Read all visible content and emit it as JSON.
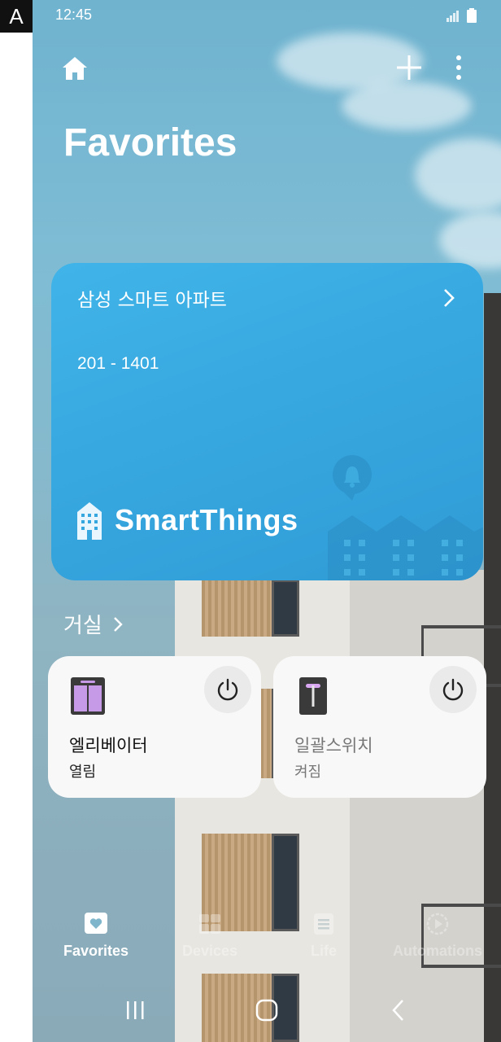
{
  "overlay": {
    "badge": "A"
  },
  "status_bar": {
    "time": "12:45"
  },
  "header": {
    "title": "Favorites"
  },
  "home_card": {
    "name": "삼성 스마트 아파트",
    "unit": "201 - 1401",
    "brand": "SmartThings"
  },
  "room": {
    "name": "거실"
  },
  "devices": [
    {
      "name": "엘리베이터",
      "state": "열림",
      "icon": "elevator-icon"
    },
    {
      "name": "일괄스위치",
      "state": "켜짐",
      "icon": "switch-icon"
    }
  ],
  "bottom_nav": {
    "items": [
      {
        "label": "Favorites",
        "icon": "heart-icon",
        "active": true
      },
      {
        "label": "Devices",
        "icon": "grid-icon",
        "active": false
      },
      {
        "label": "Life",
        "icon": "list-icon",
        "active": false
      },
      {
        "label": "Automations",
        "icon": "play-icon",
        "active": false
      }
    ]
  },
  "colors": {
    "card_blue": "#37a7df",
    "elevator_purple": "#c79ae8",
    "nav_active": "#ffffff"
  }
}
